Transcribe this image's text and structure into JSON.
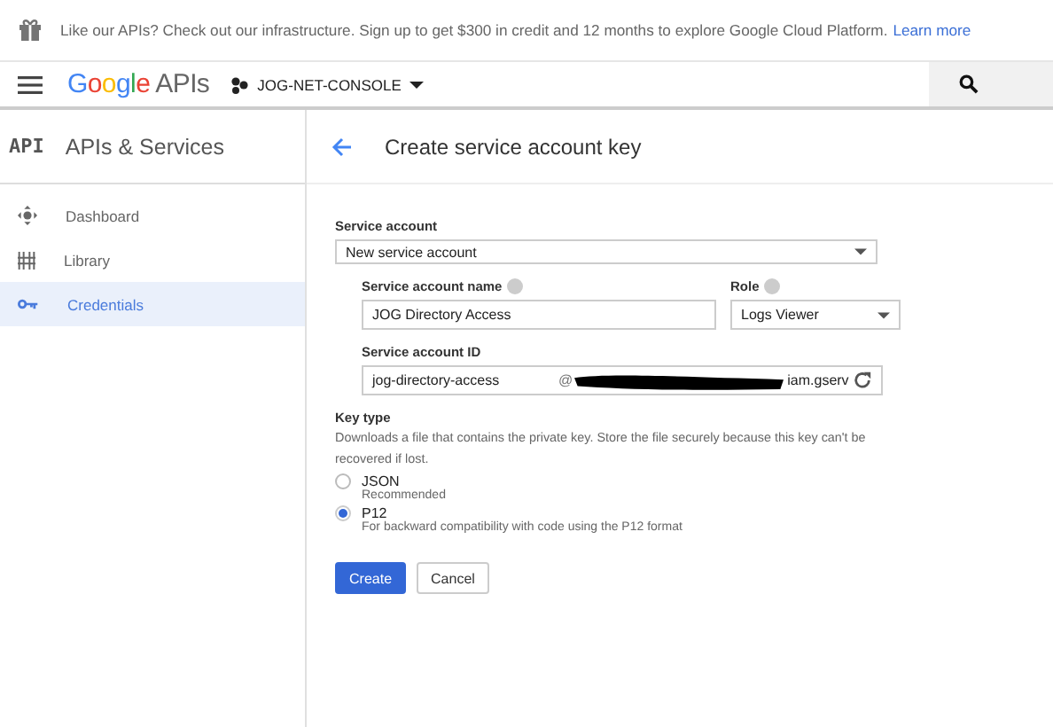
{
  "banner": {
    "text": "Like our APIs? Check out our infrastructure. Sign up to get $300 in credit and 12 months to explore Google Cloud Platform.",
    "link": "Learn more"
  },
  "topbar": {
    "brand": "Google",
    "product": "APIs",
    "project": "JOG-NET-CONSOLE"
  },
  "sidebar": {
    "logo": "API",
    "title": "APIs & Services",
    "items": [
      {
        "label": "Dashboard",
        "selected": false
      },
      {
        "label": "Library",
        "selected": false
      },
      {
        "label": "Credentials",
        "selected": true
      }
    ]
  },
  "page": {
    "title": "Create service account key"
  },
  "form": {
    "service_account": {
      "label": "Service account",
      "value": "New service account"
    },
    "name": {
      "label": "Service account name",
      "value": "JOG Directory Access"
    },
    "role": {
      "label": "Role",
      "value": "Logs Viewer"
    },
    "id": {
      "label": "Service account ID",
      "value": "jog-directory-access",
      "at": "@",
      "domain": "iam.gserv"
    },
    "key_type": {
      "label": "Key type",
      "description": "Downloads a file that contains the private key. Store the file securely because this key can't be recovered if lost.",
      "options": [
        {
          "label": "JSON",
          "hint": "Recommended",
          "selected": false
        },
        {
          "label": "P12",
          "hint": "For backward compatibility with code using the P12 format",
          "selected": true
        }
      ]
    },
    "buttons": [
      {
        "label": "Create",
        "kind": "primary"
      },
      {
        "label": "Cancel",
        "kind": "secondary"
      }
    ]
  }
}
